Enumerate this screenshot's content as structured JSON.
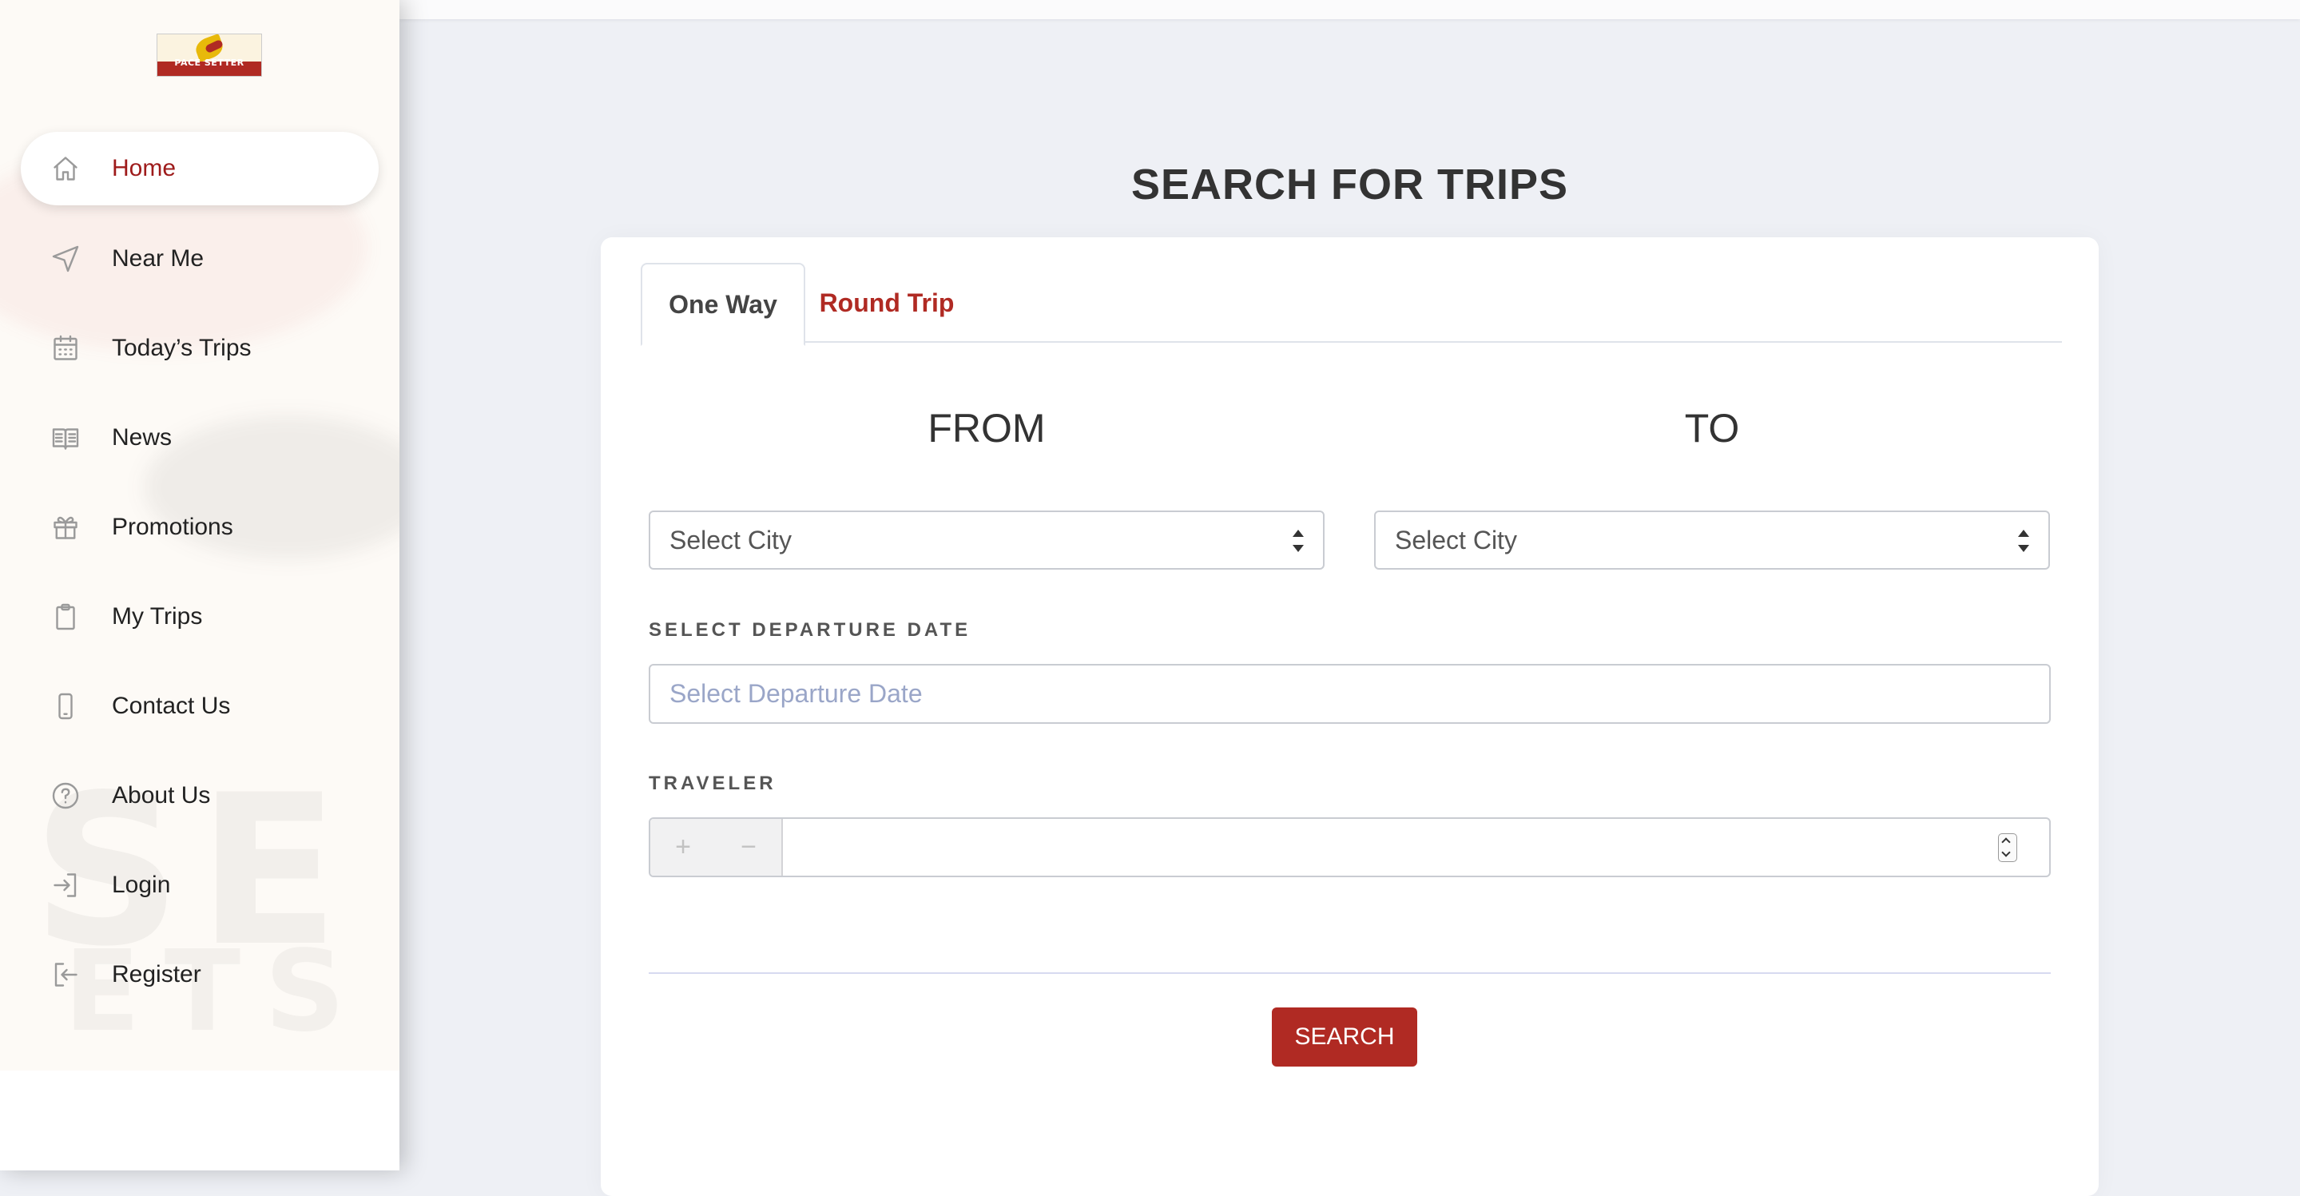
{
  "brand": {
    "logo_text": "PACE SETTER"
  },
  "sidebar": {
    "items": [
      {
        "label": "Home",
        "icon": "home-icon",
        "active": true
      },
      {
        "label": "Near Me",
        "icon": "navigation-arrow-icon"
      },
      {
        "label": "Today’s Trips",
        "icon": "calendar-icon"
      },
      {
        "label": "News",
        "icon": "newspaper-icon"
      },
      {
        "label": "Promotions",
        "icon": "gift-icon"
      },
      {
        "label": "My Trips",
        "icon": "clipboard-icon"
      },
      {
        "label": "Contact Us",
        "icon": "phone-icon"
      },
      {
        "label": "About Us",
        "icon": "help-circle-icon"
      },
      {
        "label": "Login",
        "icon": "login-icon"
      },
      {
        "label": "Register",
        "icon": "register-icon"
      }
    ]
  },
  "main": {
    "title": "SEARCH FOR TRIPS",
    "tabs": [
      {
        "label": "One Way",
        "active": true
      },
      {
        "label": "Round Trip",
        "active": false
      }
    ],
    "from_label": "FROM",
    "to_label": "TO",
    "from_select": "Select City",
    "to_select": "Select City",
    "departure_label": "SELECT DEPARTURE DATE",
    "departure_placeholder": "Select Departure Date",
    "traveler_label": "TRAVELER",
    "traveler_plus": "+",
    "traveler_minus": "−",
    "search_button": "SEARCH"
  },
  "colors": {
    "accent": "#b02a23",
    "active_nav_text": "#9e1b1b",
    "placeholder": "#9aa6c8"
  }
}
